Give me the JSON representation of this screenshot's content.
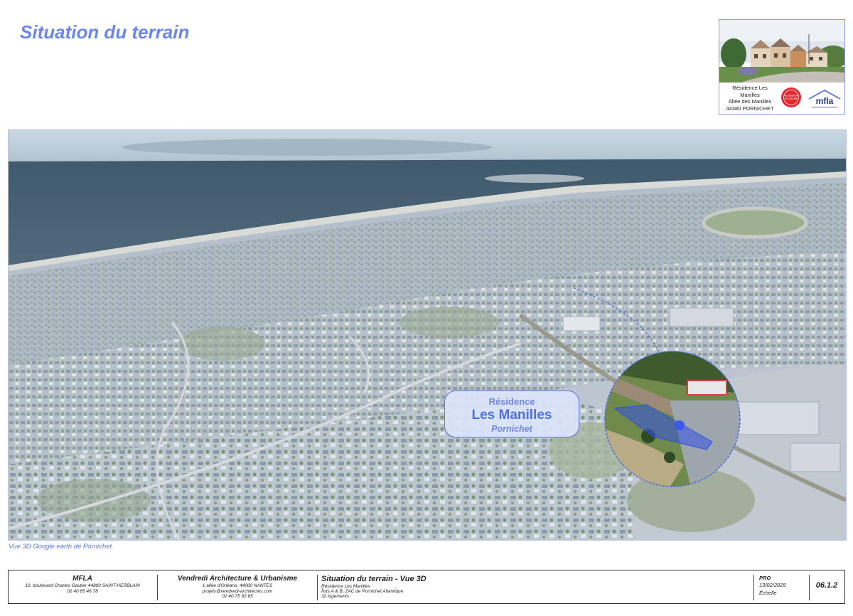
{
  "page": {
    "title": "Situation du terrain"
  },
  "project_card": {
    "address_lines": [
      "Résidence Les",
      "Manilles",
      "Allée des Manilles",
      "44380 PORNICHET"
    ],
    "seal_text": "ACCESSION SOLIDAIRE",
    "logo_text": "mfla"
  },
  "image": {
    "callout": {
      "line1": "Résidence",
      "line2": "Les Manilles",
      "line3": "Pornichet"
    },
    "caption": "Vue 3D Google earth de Pornichet"
  },
  "cartouche": {
    "mfla": {
      "name": "MFLA",
      "address": "10, boulevard Charles Gautier 44800 SAINT-HERBLAIN",
      "phone": "02 40 85 46 78"
    },
    "architect": {
      "name": "Vendredi Architecture & Urbanisme",
      "address": "1 allée d'Orléans, 44000 NANTES",
      "email": "projets@vendredi-architectes.com",
      "phone": "02 40 75 92 85"
    },
    "sheet": {
      "title": "Situation du terrain - Vue 3D",
      "lines": [
        "Résidence Les Manilles",
        "Îlots A & B, ZAC de Pornichet Atlantique",
        "32 logements"
      ]
    },
    "phase": "PRO",
    "date": "13/02/2025",
    "scale_label": "Échelle",
    "number": "06.1.2"
  },
  "colors": {
    "accent": "#6b86ec",
    "callout_border": "#5b76e6",
    "plot_highlight": "#3350e6"
  }
}
